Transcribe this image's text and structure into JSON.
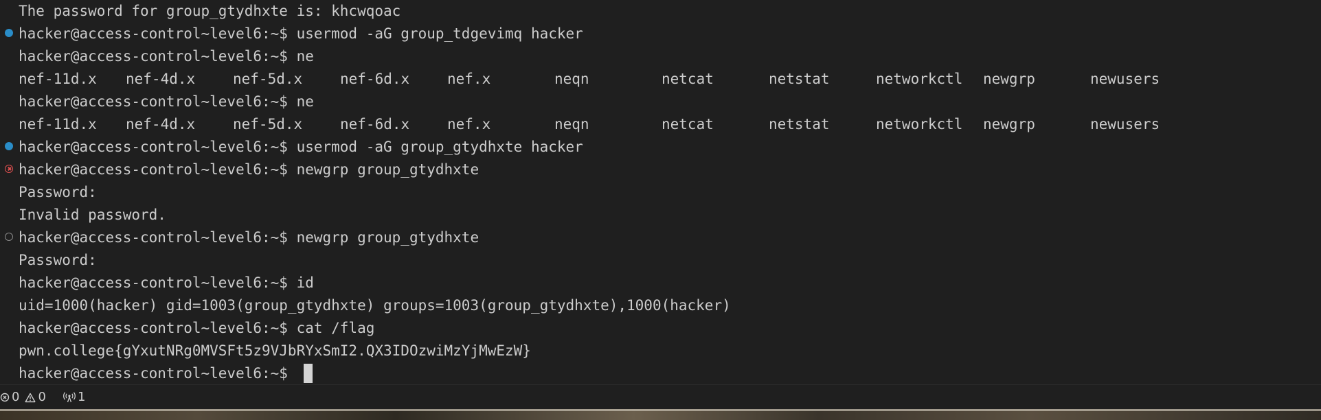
{
  "terminal": {
    "lines": [
      "The password for group_gtydhxte is: khcwqoac",
      "hacker@access-control~level6:~$ usermod -aG group_tdgevimq hacker",
      "hacker@access-control~level6:~$ ne",
      "",
      "hacker@access-control~level6:~$ ne",
      "",
      "hacker@access-control~level6:~$ usermod -aG group_gtydhxte hacker",
      "hacker@access-control~level6:~$ newgrp group_gtydhxte",
      "Password:",
      "Invalid password.",
      "hacker@access-control~level6:~$ newgrp group_gtydhxte",
      "Password:",
      "hacker@access-control~level6:~$ id",
      "uid=1000(hacker) gid=1003(group_gtydhxte) groups=1003(group_gtydhxte),1000(hacker)",
      "hacker@access-control~level6:~$ cat /flag",
      "pwn.college{gYxutNRg0MVSFt5z9VJbRYxSmI2.QX3IDOzwiMzYjMwEzW}",
      "hacker@access-control~level6:~$ "
    ],
    "completions": [
      "nef-11d.x",
      "nef-4d.x",
      "nef-5d.x",
      "nef-6d.x",
      "nef.x",
      "neqn",
      "netcat",
      "netstat",
      "networkctl",
      "newgrp",
      "newusers"
    ]
  },
  "statusbar": {
    "errors": "0",
    "warnings": "0",
    "ports": "1"
  },
  "colors": {
    "background": "#1f1f1f",
    "text": "#cccccc",
    "success_decoration": "#2a8dc8",
    "error_decoration": "#e05050"
  }
}
